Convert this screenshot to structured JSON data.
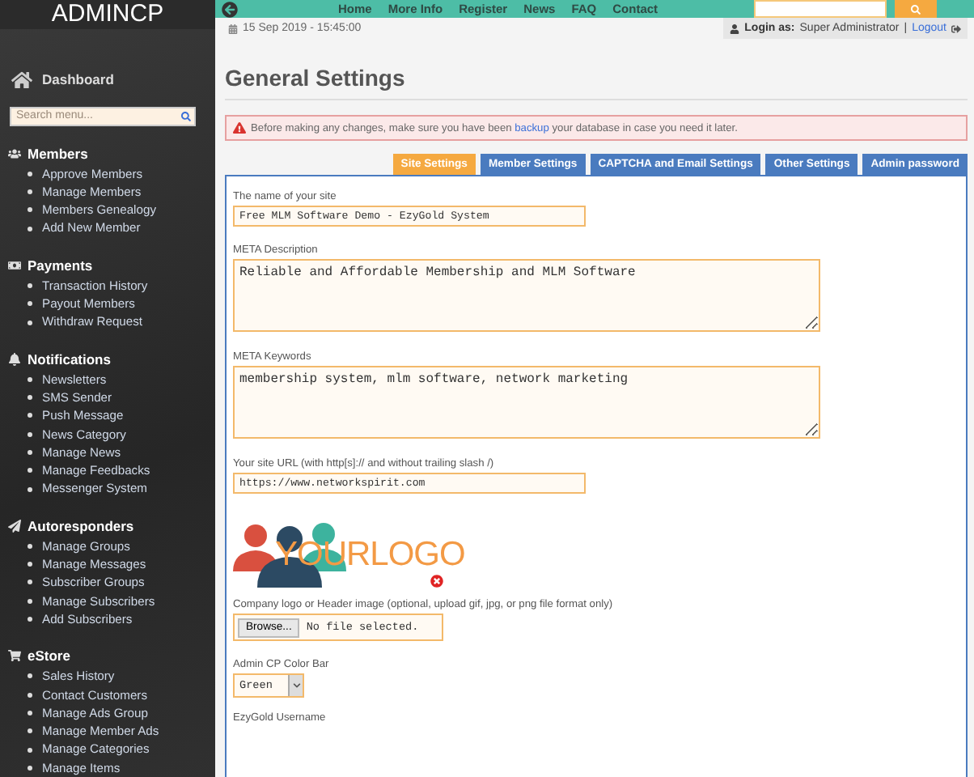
{
  "sidebar": {
    "brand": "ADMINCP",
    "dashboard": "Dashboard",
    "search": {
      "placeholder": "Search menu..."
    },
    "sections": [
      {
        "title": "Members",
        "items": [
          "Approve Members",
          "Manage Members",
          "Members Genealogy",
          "Add New Member"
        ]
      },
      {
        "title": "Payments",
        "items": [
          "Transaction History",
          "Payout Members",
          "Withdraw Request"
        ]
      },
      {
        "title": "Notifications",
        "items": [
          "Newsletters",
          "SMS Sender",
          "Push Message",
          "News Category",
          "Manage News",
          "Manage Feedbacks",
          "Messenger System"
        ]
      },
      {
        "title": "Autoresponders",
        "items": [
          "Manage Groups",
          "Manage Messages",
          "Subscriber Groups",
          "Manage Subscribers",
          "Add Subscribers"
        ]
      },
      {
        "title": "eStore",
        "items": [
          "Sales History",
          "Contact Customers",
          "Manage Ads Group",
          "Manage Member Ads",
          "Manage Categories",
          "Manage Items"
        ]
      }
    ]
  },
  "topbar": {
    "links": [
      "Home",
      "More Info",
      "Register",
      "News",
      "FAQ",
      "Contact"
    ]
  },
  "infobar": {
    "date": "15 Sep 2019 - 15:45:00",
    "login_label": "Login as:",
    "user": "Super Administrator",
    "separator": "|",
    "logout": "Logout"
  },
  "title": "General Settings",
  "alert": {
    "before": "Before making any changes, make sure you have been",
    "link": "backup",
    "after": "your database in case you need it later."
  },
  "tabs": [
    {
      "label": "Site Settings",
      "selected": true
    },
    {
      "label": "Member Settings",
      "selected": false
    },
    {
      "label": "CAPTCHA and Email Settings",
      "selected": false
    },
    {
      "label": "Other Settings",
      "selected": false
    },
    {
      "label": "Admin password",
      "selected": false
    }
  ],
  "fields": [
    {
      "kind": "input",
      "label": "The name of your site",
      "value": "Free MLM Software Demo - EzyGold System"
    },
    {
      "kind": "textarea",
      "label": "META Description",
      "value": "Reliable and Affordable Membership and MLM Software"
    },
    {
      "kind": "textarea",
      "label": "META Keywords",
      "value": "membership system, mlm software, network marketing"
    },
    {
      "kind": "input",
      "label": "Your site URL (with http[s]:// and without trailing slash /)",
      "value": "https://www.networkspirit.com"
    },
    {
      "kind": "logo",
      "text": "YOURLOGO"
    },
    {
      "kind": "file",
      "label": "Company logo or Header image (optional, upload gif, jpg, or png file format only)",
      "button": "Browse...",
      "value": "No file selected."
    },
    {
      "kind": "select",
      "label": "Admin CP Color Bar",
      "value": "Green"
    },
    {
      "kind": "label",
      "label": "EzyGold Username"
    }
  ]
}
